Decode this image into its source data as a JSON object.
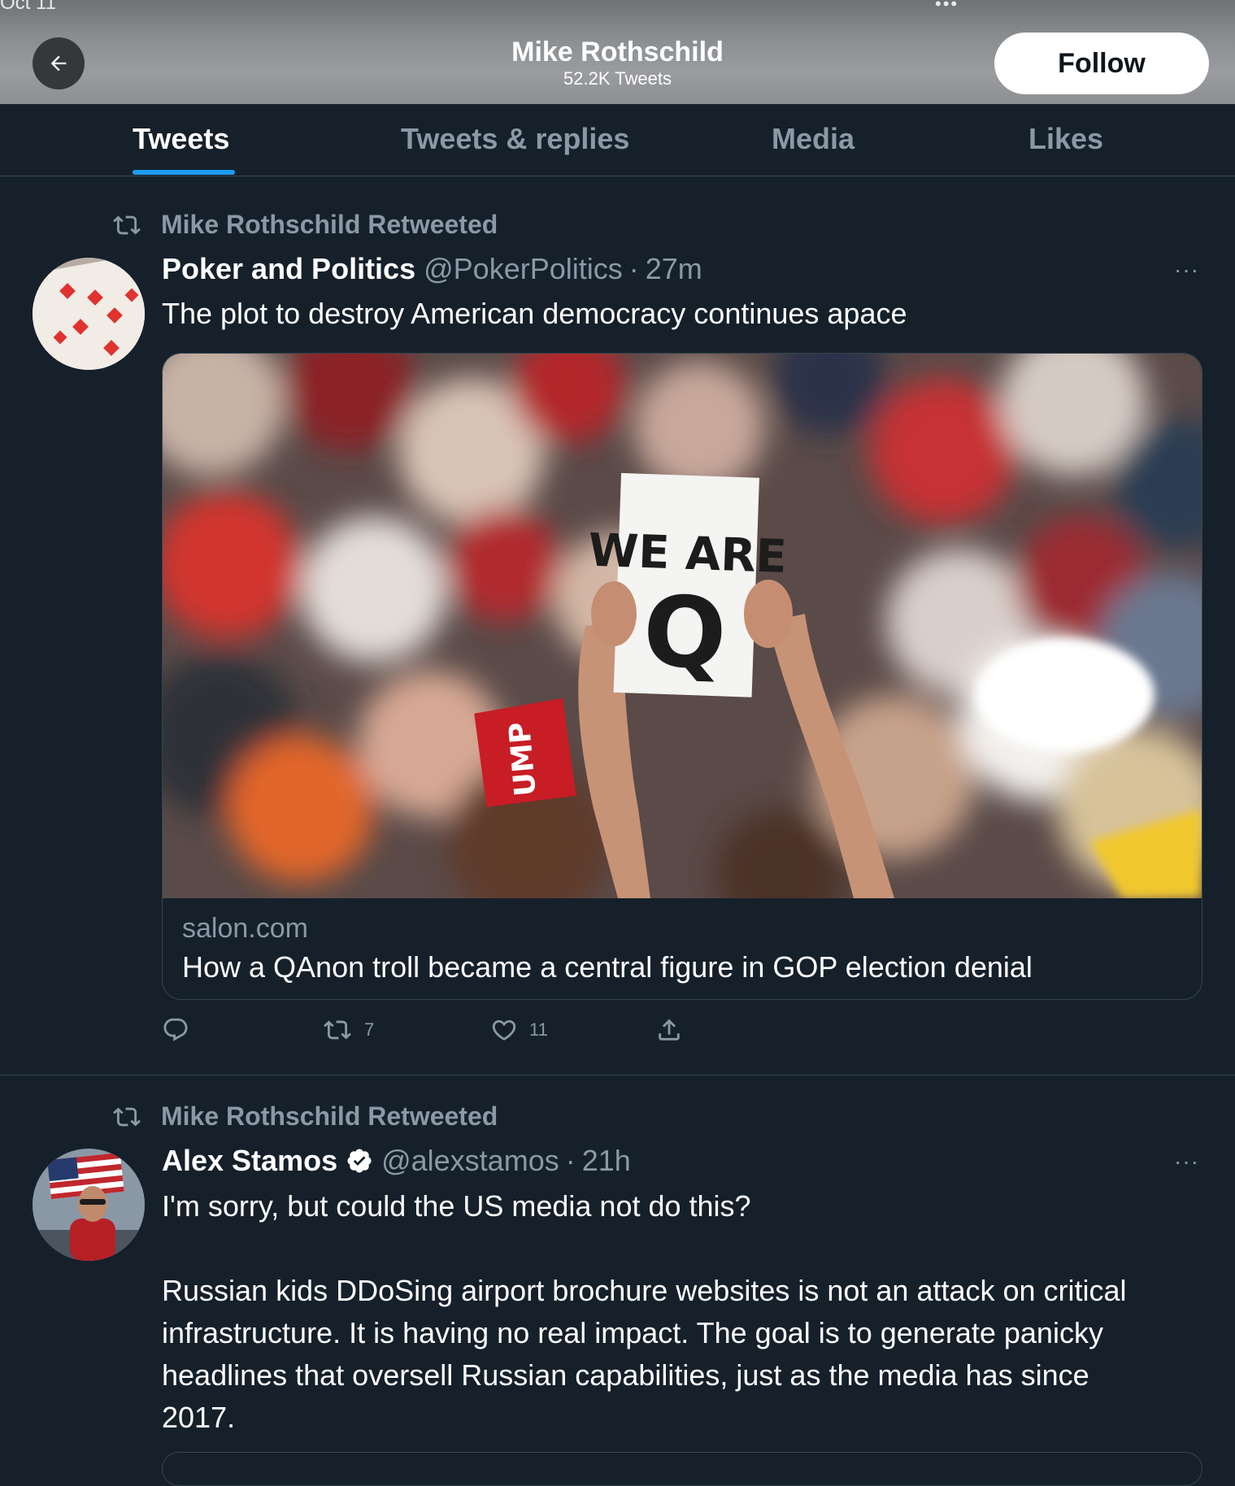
{
  "status": {
    "date": "Oct 11",
    "dots": "•••"
  },
  "header": {
    "title": "Mike Rothschild",
    "subtitle": "52.2K Tweets",
    "follow_label": "Follow"
  },
  "tabs": [
    {
      "label": "Tweets",
      "active": true
    },
    {
      "label": "Tweets & replies",
      "active": false
    },
    {
      "label": "Media",
      "active": false
    },
    {
      "label": "Likes",
      "active": false
    }
  ],
  "tweets": [
    {
      "retweet_label": "Mike Rothschild Retweeted",
      "name": "Poker and Politics",
      "handle": "@PokerPolitics",
      "separator": "·",
      "time": "27m",
      "more": "···",
      "text": "The plot to destroy American democracy continues apace",
      "card": {
        "domain": "salon.com",
        "title": "How a QAnon troll became a central figure in GOP election denial",
        "sign_line1": "WE ARE",
        "sign_line2": "Q",
        "hat_text": "UMP"
      },
      "actions": {
        "reply_count": "",
        "retweet_count": "7",
        "like_count": "11"
      }
    },
    {
      "retweet_label": "Mike Rothschild Retweeted",
      "name": "Alex Stamos",
      "handle": "@alexstamos",
      "separator": "·",
      "time": "21h",
      "more": "···",
      "text_line1": "I'm sorry, but could the US media not do this?",
      "text_para": [
        "Russian kids DDoSing airport brochure websites is not an attack on critical",
        "infrastructure. It is having no real impact. The goal is to generate panicky",
        "headlines that oversell Russian capabilities, just as the media has since",
        "2017."
      ]
    }
  ],
  "colors": {
    "background": "#15202b",
    "accent": "#1d9bf0",
    "muted": "#8b98a5",
    "border": "#38444d"
  }
}
